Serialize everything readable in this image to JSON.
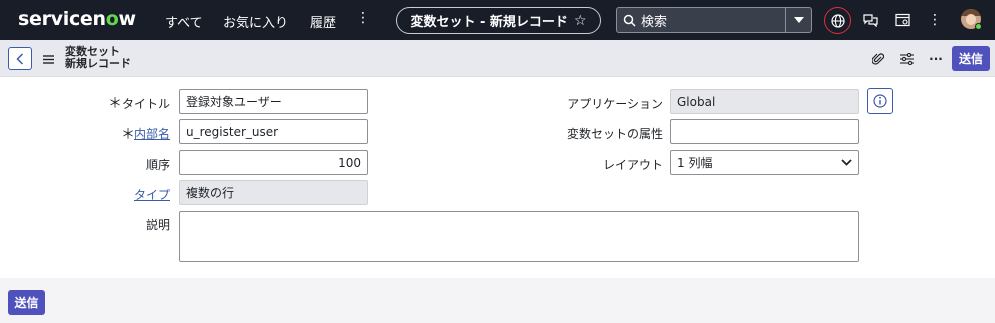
{
  "topnav": {
    "logo_part1": "servicen",
    "logo_o": "o",
    "logo_part2": "w",
    "links": [
      "すべて",
      "お気に入り",
      "履歴"
    ],
    "more_glyph": "⋮",
    "record_pill": {
      "label": "変数セット - 新規レコード",
      "star": "☆"
    },
    "search": {
      "placeholder": "検索"
    }
  },
  "form_header": {
    "title_line1": "変数セット",
    "title_line2": "新規レコード",
    "more_glyph": "···",
    "submit_label": "送信"
  },
  "form": {
    "title": {
      "label": "タイトル",
      "required": "＊",
      "value": "登録対象ユーザー"
    },
    "internal_name": {
      "label": "内部名",
      "required": "＊",
      "value": "u_register_user"
    },
    "order": {
      "label": "順序",
      "value": "100"
    },
    "type": {
      "label": "タイプ",
      "value": "複数の行"
    },
    "description": {
      "label": "説明",
      "value": ""
    },
    "application": {
      "label": "アプリケーション",
      "value": "Global"
    },
    "attributes": {
      "label": "変数セットの属性",
      "value": ""
    },
    "layout": {
      "label": "レイアウト",
      "value": "1 列幅"
    }
  },
  "footer": {
    "submit_label": "送信"
  },
  "colors": {
    "nav_bg": "#181d28",
    "accent": "#4f52bd",
    "link": "#3b5ca8",
    "logo_green": "#62d84e"
  }
}
